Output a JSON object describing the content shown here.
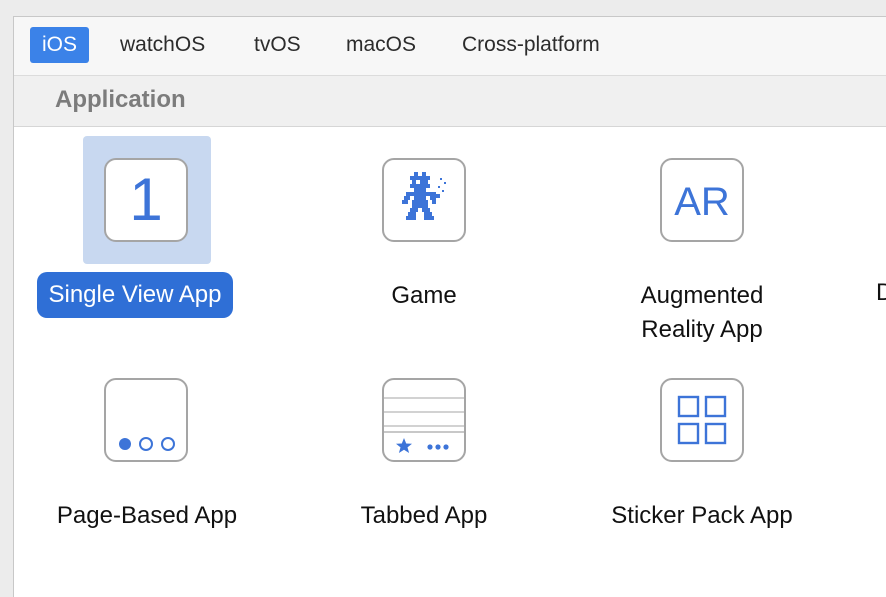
{
  "tabs": [
    {
      "label": "iOS",
      "active": true
    },
    {
      "label": "watchOS",
      "active": false
    },
    {
      "label": "tvOS",
      "active": false
    },
    {
      "label": "macOS",
      "active": false
    },
    {
      "label": "Cross-platform",
      "active": false
    }
  ],
  "section": {
    "title": "Application"
  },
  "templates": [
    {
      "label": "Single View App",
      "icon": "single-view-icon",
      "icon_text": "1",
      "selected": true
    },
    {
      "label": "Game",
      "icon": "game-sprite-icon",
      "selected": false
    },
    {
      "label_line1": "Augmented",
      "label_line2": "Reality App",
      "icon": "ar-icon",
      "icon_text": "AR",
      "selected": false
    },
    {
      "label": "Page-Based App",
      "icon": "page-dots-icon",
      "selected": false
    },
    {
      "label": "Tabbed App",
      "icon": "tab-bar-icon",
      "selected": false
    },
    {
      "label": "Sticker Pack App",
      "icon": "sticker-grid-icon",
      "selected": false
    }
  ],
  "cut_off_label": "D",
  "colors": {
    "accent": "#3b82e8",
    "selected_label": "#2f6fd6",
    "selection_bg": "#c8d8f0",
    "icon_blue": "#3d74d8"
  }
}
